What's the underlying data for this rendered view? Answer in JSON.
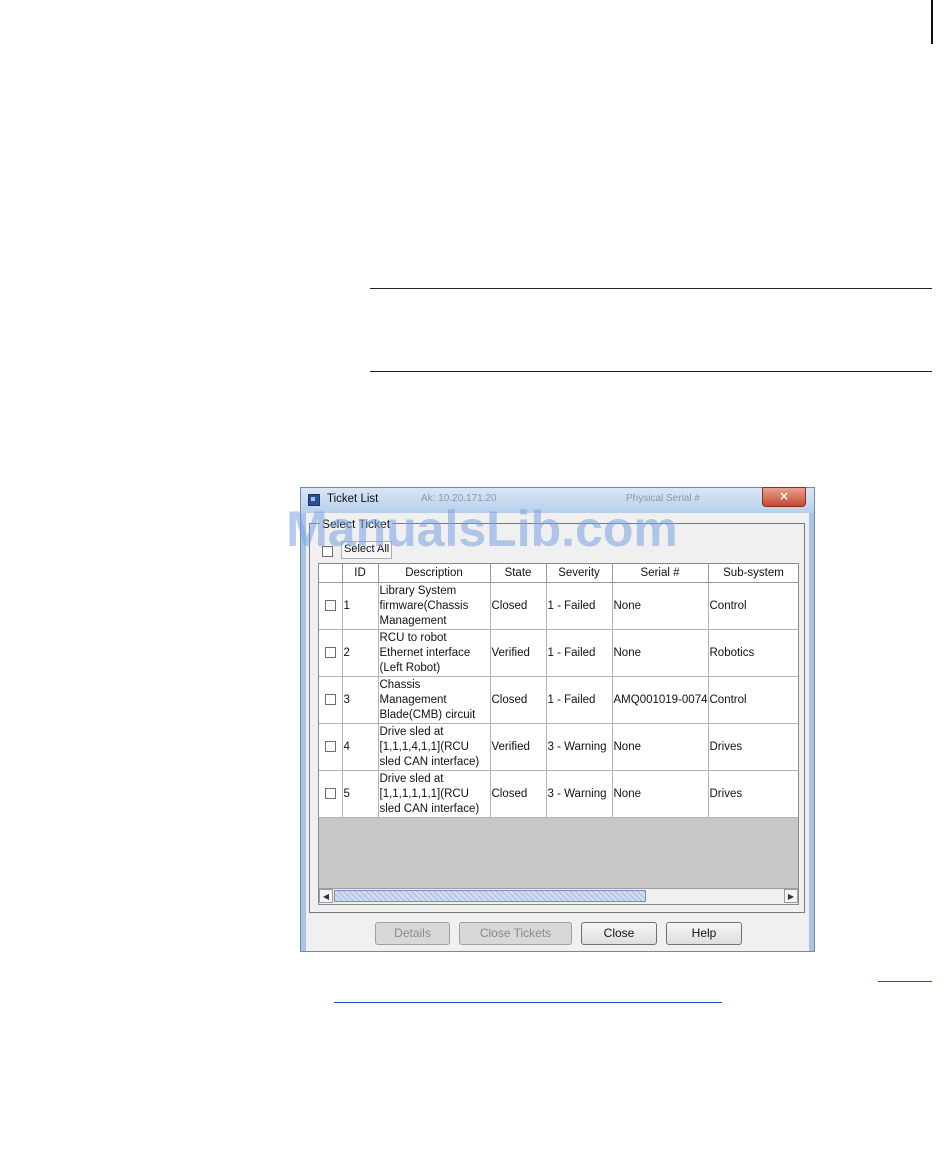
{
  "watermark": "ManualsLib.com",
  "dialog": {
    "title": "Ticket List",
    "title_blur_left": "Ak: 10.20.171.20",
    "title_blur_right": "Physical Serial #",
    "close_glyph": "×",
    "group_label": "Select Ticket",
    "select_all_label": "Select All",
    "columns": [
      "",
      "ID",
      "Description",
      "State",
      "Severity",
      "Serial #",
      "Sub-system"
    ],
    "rows": [
      {
        "id": "1",
        "description": "Library System firmware(Chassis Management",
        "state": "Closed",
        "severity": "1 - Failed",
        "serial": "None",
        "subsystem": "Control"
      },
      {
        "id": "2",
        "description": "RCU to robot Ethernet interface (Left Robot)",
        "state": "Verified",
        "severity": "1 - Failed",
        "serial": "None",
        "subsystem": "Robotics"
      },
      {
        "id": "3",
        "description": "Chassis Management Blade(CMB) circuit",
        "state": "Closed",
        "severity": "1 - Failed",
        "serial": "AMQ001019-0074",
        "subsystem": "Control"
      },
      {
        "id": "4",
        "description": "Drive sled at [1,1,1,4,1,1](RCU sled CAN interface)",
        "state": "Verified",
        "severity": "3 - Warning",
        "serial": "None",
        "subsystem": "Drives"
      },
      {
        "id": "5",
        "description": "Drive sled at [1,1,1,1,1,1](RCU sled CAN interface)",
        "state": "Closed",
        "severity": "3 - Warning",
        "serial": "None",
        "subsystem": "Drives"
      }
    ],
    "scroll_left_glyph": "◀",
    "scroll_right_glyph": "▶",
    "buttons": {
      "details": "Details",
      "close_tickets": "Close Tickets",
      "close": "Close",
      "help": "Help"
    }
  },
  "colors": {
    "watermark": "#78a0e1",
    "dialog_frame": "#aac4e6",
    "link": "#1a56c8",
    "close_button": "#c44a33"
  },
  "icons": [
    "ticket-list-app-icon",
    "close-icon",
    "scroll-left-arrow-icon",
    "scroll-right-arrow-icon"
  ]
}
